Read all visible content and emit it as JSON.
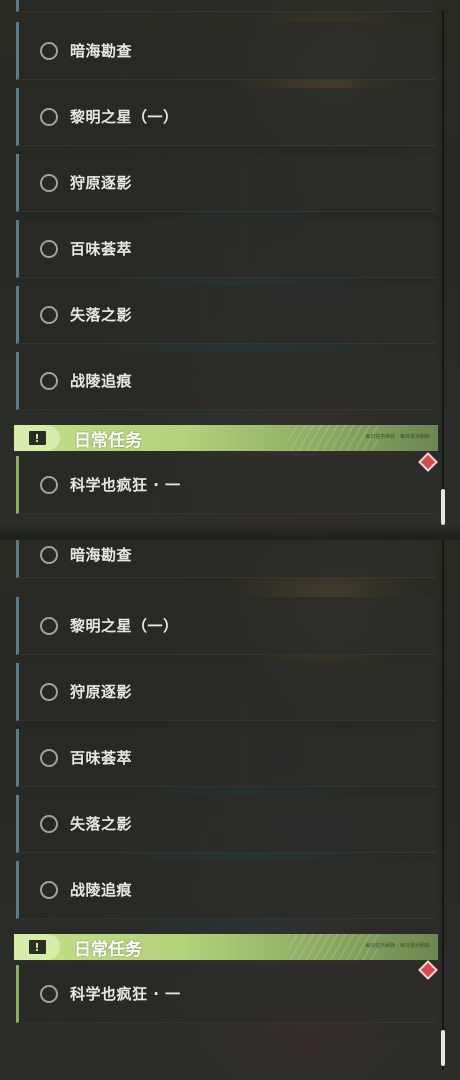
{
  "quests": [
    {
      "label": "暗海勘查"
    },
    {
      "label": "黎明之星（一）"
    },
    {
      "label": "狩原逐影"
    },
    {
      "label": "百味荟萃"
    },
    {
      "label": "失落之影"
    },
    {
      "label": "战陵追痕"
    }
  ],
  "daily_section": {
    "title": "日常任务",
    "icon_glyph": "!",
    "icon_name": "exclamation-icon",
    "small_text": "每日任务刷新 · 每日零点刷新"
  },
  "daily_quests": [
    {
      "label": "科学也疯狂 · 一"
    }
  ],
  "colors": {
    "accent_green": "#b4d27a",
    "row_border_blue": "#5a7b87",
    "row_border_green": "#8fae64",
    "marker_red": "#d8484f"
  }
}
